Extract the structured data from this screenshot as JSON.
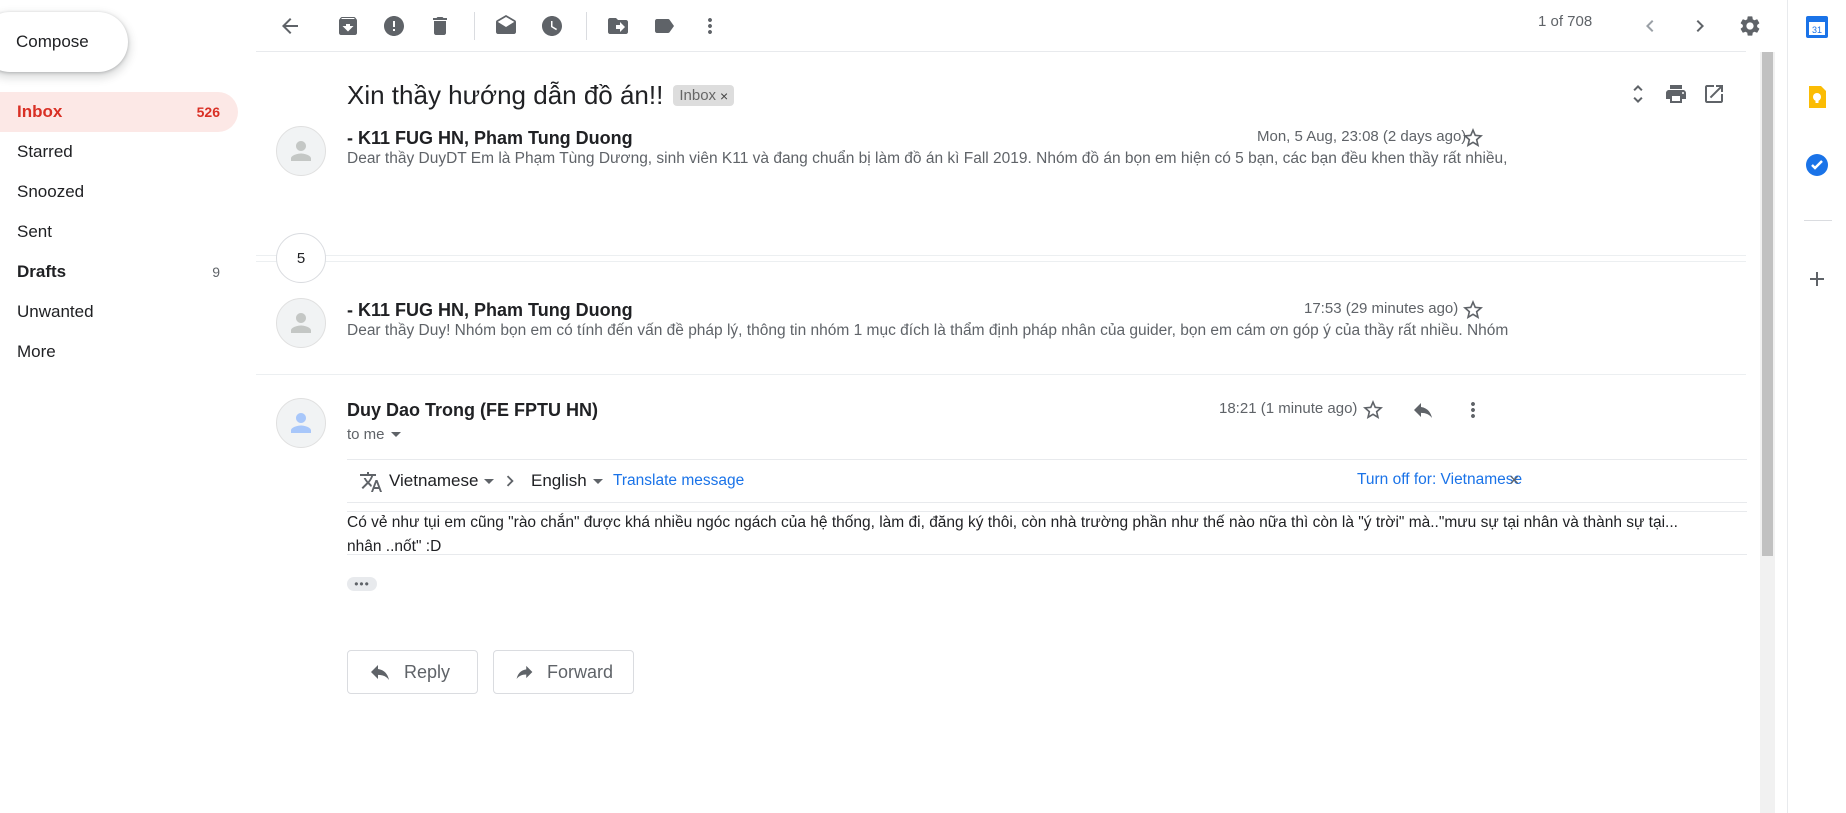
{
  "nav": {
    "compose_label": "Compose",
    "items": [
      {
        "label": "Inbox",
        "count": "526"
      },
      {
        "label": "Starred",
        "count": ""
      },
      {
        "label": "Snoozed",
        "count": ""
      },
      {
        "label": "Sent",
        "count": ""
      },
      {
        "label": "Drafts",
        "count": "9"
      },
      {
        "label": "Unwanted",
        "count": ""
      },
      {
        "label": "More",
        "count": ""
      }
    ]
  },
  "toolbar": {
    "pager": "1 of 708",
    "icons": [
      "back-arrow-icon",
      "archive-icon",
      "report-spam-icon",
      "delete-icon",
      "mark-unread-icon",
      "snooze-icon",
      "move-to-icon",
      "labels-icon",
      "more-vert-icon",
      "chevron-left-icon",
      "chevron-right-icon",
      "settings-icon"
    ]
  },
  "thread": {
    "subject": "Xin thầy hướng dẫn đồ án!!",
    "label_chip": "Inbox",
    "collapsed_count": "5",
    "messages": [
      {
        "sender": "- K11 FUG HN, Pham Tung Duong",
        "date": "Mon, 5 Aug, 23:08 (2 days ago)",
        "snippet": "Dear thầy DuyDT Em là Phạm Tùng Dương, sinh viên K11 và đang chuẩn bị làm đồ án kì Fall 2019. Nhóm đồ án bọn em hiện có 5 bạn, các bạn đều khen thầy rất nhiều,"
      },
      {
        "sender": "- K11 FUG HN, Pham Tung Duong",
        "date": "17:53 (29 minutes ago)",
        "snippet": "Dear thầy Duy! Nhóm bọn em có tính đến vấn đề pháp lý, thông tin nhóm 1 mục đích là thẩm định pháp nhân của guider, bọn em cám ơn góp ý của thầy rất nhiều. Nhóm"
      },
      {
        "sender": "Duy Dao Trong (FE FPTU HN)",
        "date": "18:21 (1 minute ago)",
        "to": "to me",
        "body_line1": "Có vẻ như tụi em cũng \"rào chắn\" được khá nhiều ngóc ngách của hệ thống, làm đi, đăng ký thôi, còn nhà trường phần như thế nào nữa thì còn là \"ý trời\" mà..\"mưu sự tại nhân và thành sự tại...",
        "body_line2": "nhân ..nốt\" :D",
        "ellipsis": "•••"
      }
    ]
  },
  "translate": {
    "source_lang": "Vietnamese",
    "target_lang": "English",
    "translate_link": "Translate message",
    "turn_off_link": "Turn off for: Vietnamese"
  },
  "actions": {
    "reply_label": "Reply",
    "forward_label": "Forward"
  },
  "side_panel": {
    "calendar_day": "31",
    "colors": {
      "calendar": "#1a73e8",
      "keep": "#fbbc04",
      "tasks": "#1a73e8"
    }
  }
}
